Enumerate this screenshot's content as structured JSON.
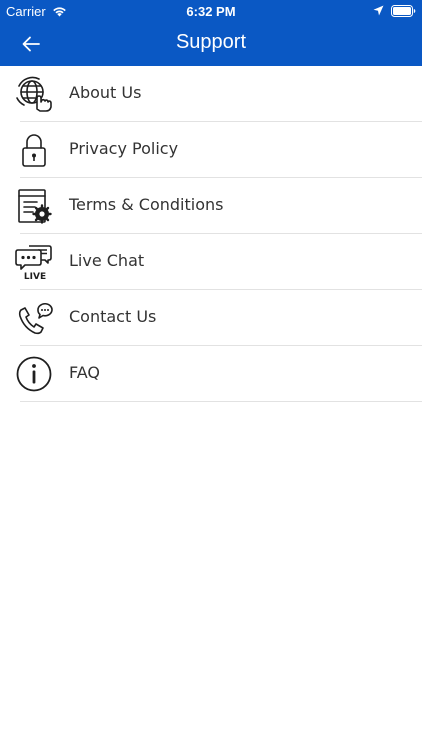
{
  "colors": {
    "accent": "#0a58c4",
    "icon": "#1f1f1f",
    "text": "#333333"
  },
  "status_bar": {
    "carrier": "Carrier",
    "time": "6:32 PM"
  },
  "nav": {
    "title": "Support",
    "back_icon": "arrow-left-icon"
  },
  "menu": {
    "items": [
      {
        "label": "About Us",
        "icon": "globe-hand-icon"
      },
      {
        "label": "Privacy Policy",
        "icon": "padlock-icon"
      },
      {
        "label": "Terms & Conditions",
        "icon": "document-gear-icon"
      },
      {
        "label": "Live Chat",
        "icon": "live-chat-icon"
      },
      {
        "label": "Contact Us",
        "icon": "phone-chat-icon"
      },
      {
        "label": "FAQ",
        "icon": "info-icon"
      }
    ]
  }
}
